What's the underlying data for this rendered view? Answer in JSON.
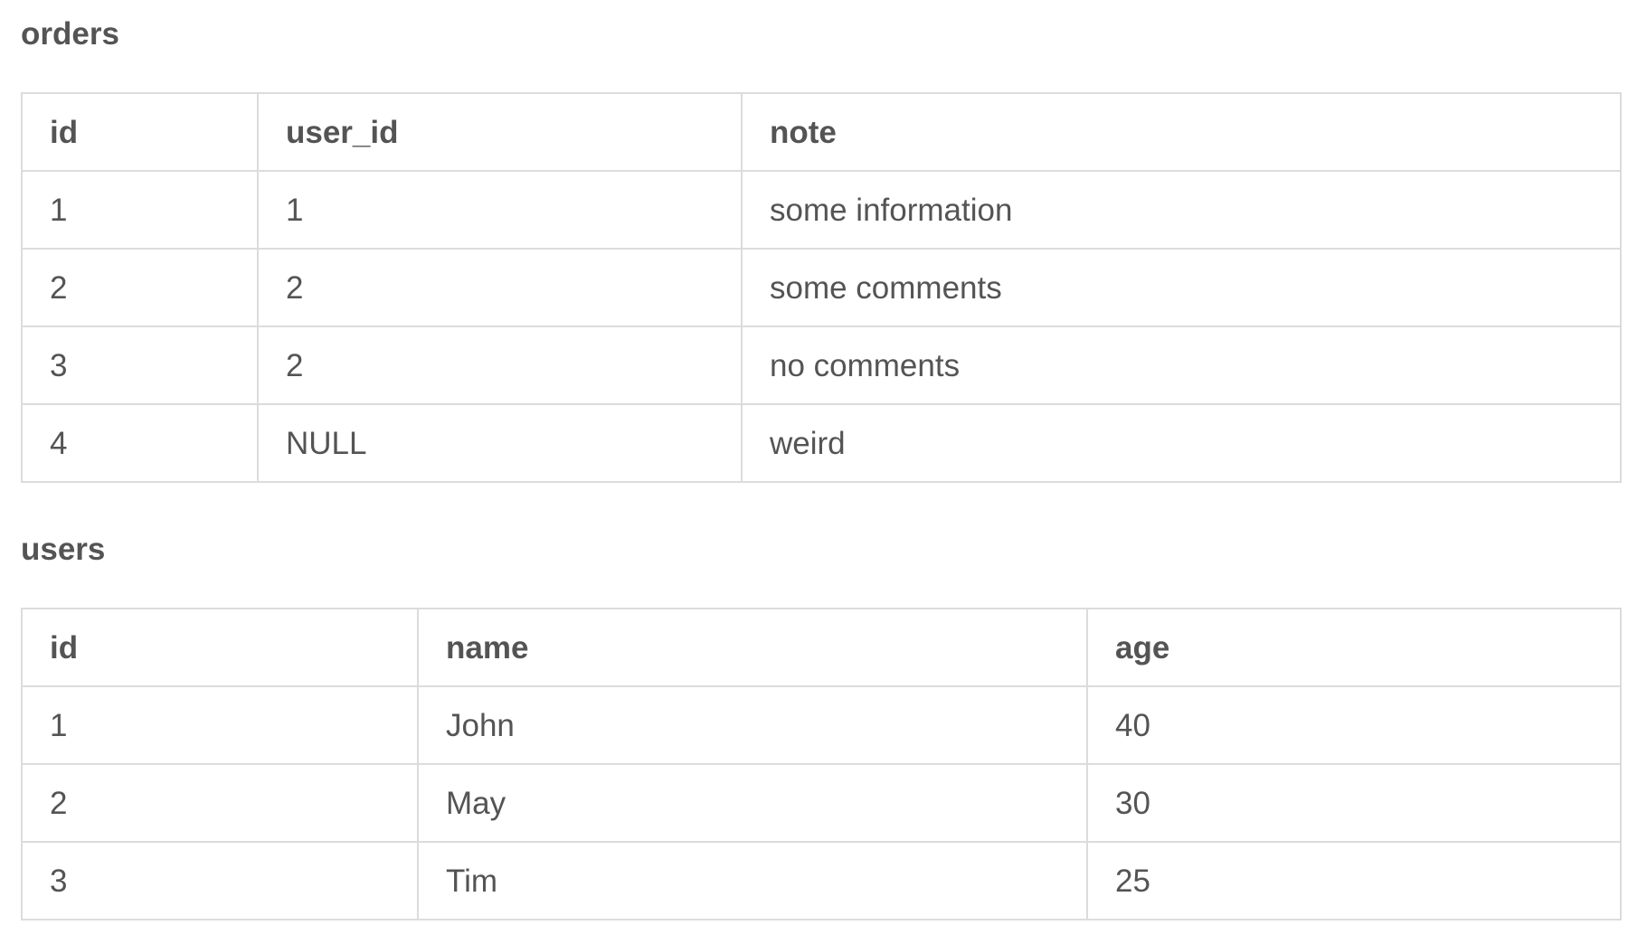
{
  "orders": {
    "title": "orders",
    "columns": [
      "id",
      "user_id",
      "note"
    ],
    "rows": [
      [
        "1",
        "1",
        "some information"
      ],
      [
        "2",
        "2",
        "some comments"
      ],
      [
        "3",
        "2",
        "no comments"
      ],
      [
        "4",
        "NULL",
        "weird"
      ]
    ]
  },
  "users": {
    "title": "users",
    "columns": [
      "id",
      "name",
      "age"
    ],
    "rows": [
      [
        "1",
        "John",
        "40"
      ],
      [
        "2",
        "May",
        "30"
      ],
      [
        "3",
        "Tim",
        "25"
      ]
    ]
  }
}
